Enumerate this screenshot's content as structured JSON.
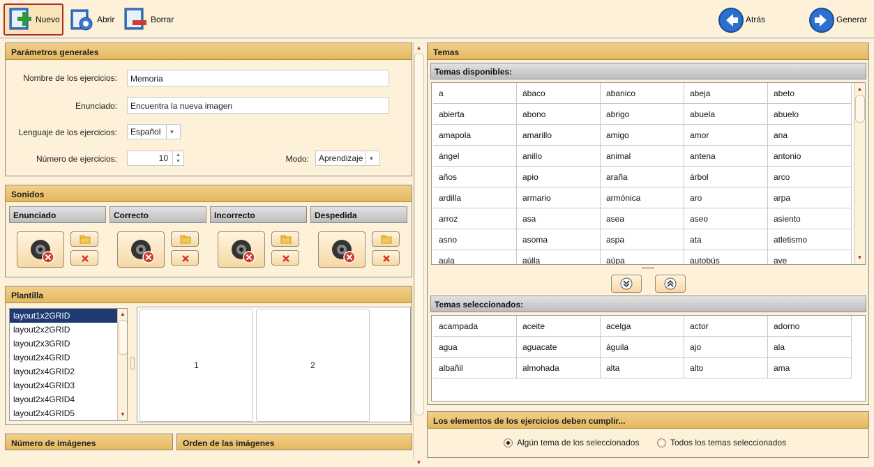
{
  "toolbar": {
    "nuevo": "Nuevo",
    "abrir": "Abrir",
    "borrar": "Borrar",
    "atras": "Atrás",
    "generar": "Generar"
  },
  "parametros": {
    "title": "Parámetros generales",
    "nombre_label": "Nombre de los ejercicios:",
    "nombre_value": "Memoria",
    "enunciado_label": "Enunciado:",
    "enunciado_value": "Encuentra la nueva imagen",
    "lenguaje_label": "Lenguaje de los ejercicios:",
    "lenguaje_value": "Español",
    "numero_label": "Número de ejercicios:",
    "numero_value": "10",
    "modo_label": "Modo:",
    "modo_value": "Aprendizaje"
  },
  "sonidos": {
    "title": "Sonidos",
    "items": [
      "Enunciado",
      "Correcto",
      "Incorrecto",
      "Despedida"
    ]
  },
  "plantilla": {
    "title": "Plantilla",
    "layouts": [
      "layout1x2GRID",
      "layout2x2GRID",
      "layout2x3GRID",
      "layout2x4GRID",
      "layout2x4GRID2",
      "layout2x4GRID3",
      "layout2x4GRID4",
      "layout2x4GRID5"
    ],
    "cells": [
      "1",
      "2"
    ]
  },
  "bottom": {
    "numero_imagenes": "Número de imágenes",
    "orden_imagenes": "Orden de las imágenes"
  },
  "temas": {
    "title": "Temas",
    "disponibles_label": "Temas disponibles:",
    "disponibles": [
      "a",
      "ábaco",
      "abanico",
      "abeja",
      "abeto",
      "abierta",
      "abono",
      "abrigo",
      "abuela",
      "abuelo",
      "amapola",
      "amarillo",
      "amigo",
      "amor",
      "ana",
      "ángel",
      "anillo",
      "animal",
      "antena",
      "antonio",
      "años",
      "apio",
      "araña",
      "árbol",
      "arco",
      "ardilla",
      "armario",
      "armónica",
      "aro",
      "arpa",
      "arroz",
      "asa",
      "asea",
      "aseo",
      "asiento",
      "asno",
      "asoma",
      "aspa",
      "ata",
      "atletismo",
      "aula",
      "aúlla",
      "aúpa",
      "autobús",
      "ave"
    ],
    "seleccionados_label": "Temas seleccionados:",
    "seleccionados": [
      "acampada",
      "aceite",
      "acelga",
      "actor",
      "adorno",
      "agua",
      "aguacate",
      "águila",
      "ajo",
      "ala",
      "albañil",
      "almohada",
      "alta",
      "alto",
      "ama"
    ]
  },
  "condicion": {
    "title": "Los elementos de los ejercicios deben cumplir...",
    "opt1": "Algún tema de los seleccionados",
    "opt2": "Todos los temas seleccionados",
    "selected": 1
  },
  "colors": {
    "header": "#e4b85e",
    "background": "#fdf1d9",
    "selection": "#1f3a73"
  }
}
